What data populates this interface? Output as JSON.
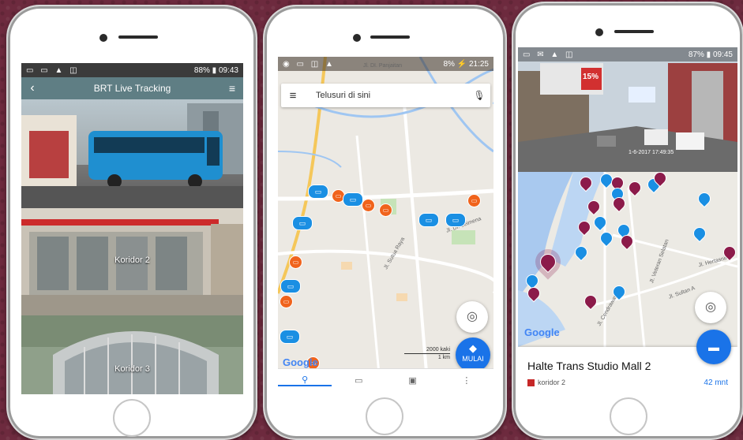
{
  "phone1": {
    "status_right": "88% ▮ 09:43",
    "title": "BRT Live Tracking",
    "tiles": [
      {
        "label": ""
      },
      {
        "label": "Koridor 2"
      },
      {
        "label": "Koridor 3"
      }
    ]
  },
  "phone2": {
    "status_right": "8% ⚡ 21:25",
    "search_placeholder": "Telusuri di sini",
    "road_labels": [
      "Jl. DI. Panjaitan",
      "Jl. Sultan",
      "Jl. Dr. Leimena",
      "Jl. Sutua Raya"
    ],
    "scale_top": "2000 kaki",
    "scale_bottom": "1 km",
    "go_label": "MULAI",
    "google": "Google",
    "nav_icons": [
      "explore-icon",
      "car-icon",
      "bus-icon",
      "more-icon"
    ]
  },
  "phone3": {
    "status_right": "87% ▮ 09:45",
    "camera_timestamp": "1-6-2017 17:49:35",
    "billboard_text": "15%",
    "road_labels": [
      "Jl. Veteran Selatan",
      "Jl. Cendrawasih",
      "Jl. Sultan A",
      "Jl. Hertasning"
    ],
    "google": "Google",
    "stop_name": "Halte Trans Studio Mall 2",
    "corridor": "koridor 2",
    "eta": "42 mnt"
  },
  "colors": {
    "background": "#6d2a3e",
    "appbar": "#5f7e84",
    "accent_blue": "#1a73e8",
    "marker_blue": "#1a8fe3",
    "marker_orange": "#f0631c",
    "marker_maroon": "#8c1b4a"
  }
}
